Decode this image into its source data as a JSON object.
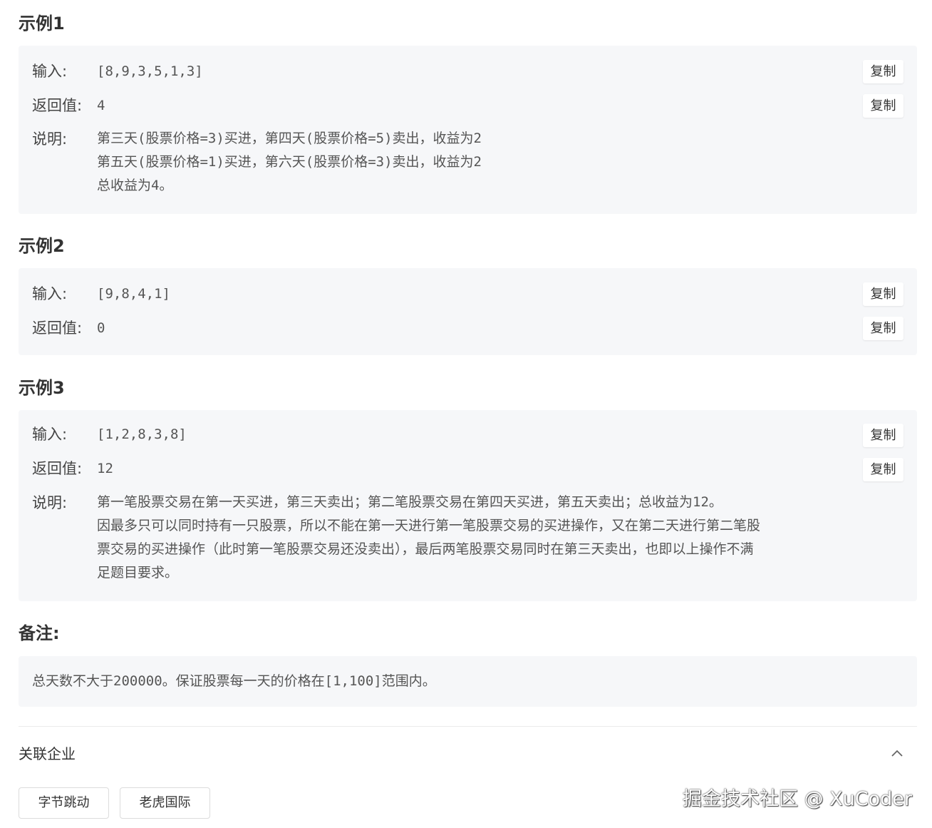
{
  "examples": [
    {
      "title": "示例1",
      "input_label": "输入:",
      "input_value": "[8,9,3,5,1,3]",
      "return_label": "返回值:",
      "return_value": "4",
      "explain_label": "说明:",
      "explain_lines": [
        "第三天(股票价格=3)买进，第四天(股票价格=5)卖出，收益为2",
        "第五天(股票价格=1)买进，第六天(股票价格=3)卖出，收益为2",
        "总收益为4。"
      ]
    },
    {
      "title": "示例2",
      "input_label": "输入:",
      "input_value": "[9,8,4,1]",
      "return_label": "返回值:",
      "return_value": "0"
    },
    {
      "title": "示例3",
      "input_label": "输入:",
      "input_value": "[1,2,8,3,8]",
      "return_label": "返回值:",
      "return_value": "12",
      "explain_label": "说明:",
      "explain_lines": [
        "第一笔股票交易在第一天买进，第三天卖出；第二笔股票交易在第四天买进，第五天卖出；总收益为12。",
        "因最多只可以同时持有一只股票，所以不能在第一天进行第一笔股票交易的买进操作，又在第二天进行第二笔股",
        "票交易的买进操作（此时第一笔股票交易还没卖出），最后两笔股票交易同时在第三天卖出，也即以上操作不满",
        "足题目要求。"
      ]
    }
  ],
  "copy_label": "复制",
  "note": {
    "title": "备注:",
    "text": "总天数不大于200000。保证股票每一天的价格在[1,100]范围内。"
  },
  "related": {
    "title": "关联企业",
    "tags": [
      "字节跳动",
      "老虎国际"
    ]
  },
  "watermark": "掘金技术社区 @ XuCoder"
}
